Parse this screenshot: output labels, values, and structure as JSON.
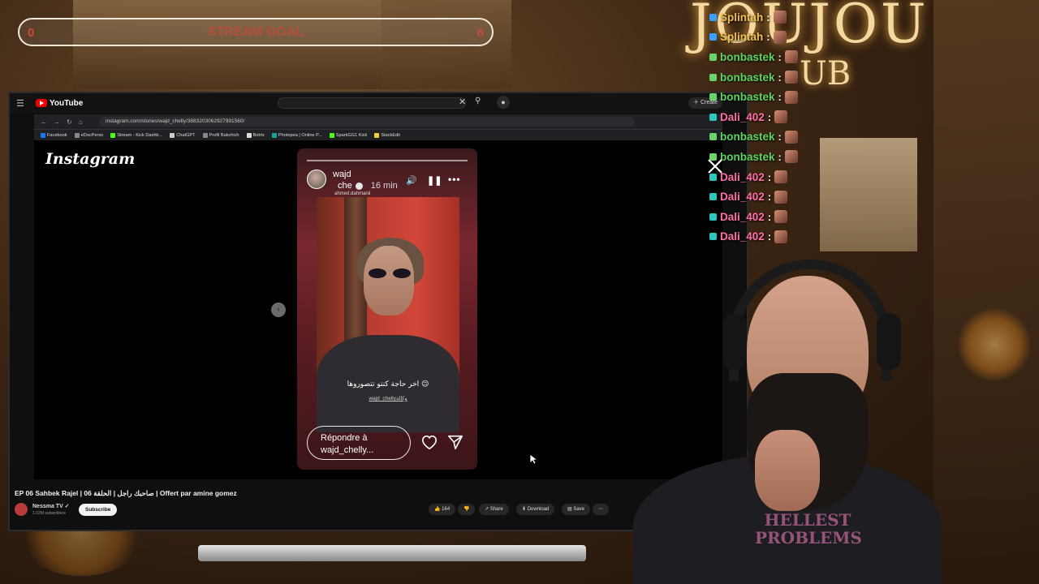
{
  "overlay": {
    "goal": {
      "min": "0",
      "label": "STREAM GOAL",
      "max": "8"
    },
    "sign": {
      "line1": "JOUJOU",
      "line2": "UB"
    }
  },
  "youtube": {
    "brand": "YouTube",
    "search_placeholder": "",
    "create_label": "Create",
    "video_title": "EP 06 Sahbek Rajel | صاحبك راجل | الحلقة 06 | Offert par amine gomez",
    "channel_name": "Nessma TV ✓",
    "channel_subs": "1.02M subscribers",
    "subscribe_label": "Subscribe",
    "actions": {
      "likes": "164",
      "share": "Share",
      "download": "Download",
      "save": "Save"
    }
  },
  "browser": {
    "url": "instagram.com/stories/wajd_chelly/3883203062927991560/",
    "bookmarks": [
      {
        "label": "Facebook",
        "color": "#1877f2"
      },
      {
        "label": "eDocPerso",
        "color": "#888888"
      },
      {
        "label": "Stream - Kick Dashb...",
        "color": "#53fc18"
      },
      {
        "label": "ChatGPT",
        "color": "#cccccc"
      },
      {
        "label": "Profil Bakchich",
        "color": "#888888"
      },
      {
        "label": "Botrix",
        "color": "#dddddd"
      },
      {
        "label": "Photopea | Online P...",
        "color": "#18a497"
      },
      {
        "label": "SparkGG1 Kick",
        "color": "#53fc18"
      },
      {
        "label": "StackEdit",
        "color": "#f5d02a"
      }
    ]
  },
  "instagram": {
    "logo": "Instagram",
    "story": {
      "username": "wajd",
      "subname": "che",
      "time": "16 min",
      "credit": "ahmed.dahmanii",
      "caption": "اخر حاجة كنتو تتصوروها 😉",
      "mention": "wajd_chellyوكالة",
      "reply_line1": "Répondre à",
      "reply_line2": "wajd_chelly..."
    }
  },
  "chat": [
    {
      "name": "Splintah",
      "color": "#f2c14e",
      "badge": "#3aa0ff"
    },
    {
      "name": "Splintah",
      "color": "#f2c14e",
      "badge": "#3aa0ff"
    },
    {
      "name": "bonbastek",
      "color": "#5fd35f",
      "badge": "#6ad46a"
    },
    {
      "name": "bonbastek",
      "color": "#5fd35f",
      "badge": "#6ad46a"
    },
    {
      "name": "bonbastek",
      "color": "#5fd35f",
      "badge": "#6ad46a"
    },
    {
      "name": "Dali_402",
      "color": "#ff6fa8",
      "badge": "#2fc6c2"
    },
    {
      "name": "bonbastek",
      "color": "#5fd35f",
      "badge": "#6ad46a"
    },
    {
      "name": "bonbastek",
      "color": "#5fd35f",
      "badge": "#6ad46a"
    },
    {
      "name": "Dali_402",
      "color": "#ff6fa8",
      "badge": "#2fc6c2"
    },
    {
      "name": "Dali_402",
      "color": "#ff6fa8",
      "badge": "#2fc6c2"
    },
    {
      "name": "Dali_402",
      "color": "#ff6fa8",
      "badge": "#2fc6c2"
    },
    {
      "name": "Dali_402",
      "color": "#ff6fa8",
      "badge": "#2fc6c2"
    }
  ],
  "webcam": {
    "shirt_print": "HELLEST PROBLEMS"
  }
}
